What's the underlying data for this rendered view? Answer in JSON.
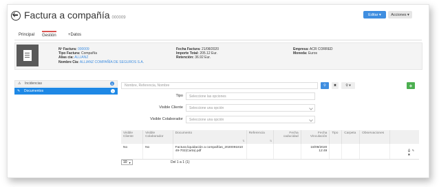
{
  "header": {
    "title": "Factura a compañía",
    "id": "000009",
    "edit_label": "Editar ▾",
    "actions_label": "Acciones ▾"
  },
  "tabs": [
    {
      "label": "Principal"
    },
    {
      "label": "Gestión"
    },
    {
      "label": "+Datos"
    }
  ],
  "info": {
    "col1": {
      "nfactura_label": "Nº Factura:",
      "nfactura_value": "000009",
      "tipo_label": "Tipo Factura:",
      "tipo_value": "Compañía",
      "alias_label": "Alias cia:",
      "alias_value": "ALLIANZ",
      "nombre_label": "Nombre Cía:",
      "nombre_value": "ALLIANZ COMPAÑÍA DE SEGUROS S.A."
    },
    "col2": {
      "fecha_label": "Fecha Factura:",
      "fecha_value": "21/08/2020",
      "importe_label": "Importe Total:",
      "importe_value": "205.12 Eur.",
      "retencion_label": "Retención:",
      "retencion_value": "36.92 Eur."
    },
    "col3": {
      "empresa_label": "Empresa:",
      "empresa_value": "ACR CORRED",
      "moneda_label": "Moneda:",
      "moneda_value": "Euros"
    }
  },
  "sidebar": {
    "items": [
      {
        "label": "Incidencias",
        "count": "0"
      },
      {
        "label": "Documentos",
        "count": "1"
      }
    ]
  },
  "search": {
    "placeholder": "Nombre, Referencia, Nombre"
  },
  "filters": {
    "tipo_label": "Tipo",
    "tipo_placeholder": "Seleccione las opciones",
    "visible_cliente_label": "Visible Cliente",
    "visible_cliente_placeholder": "Seleccione una opción",
    "visible_colaborador_label": "Visible Colaborador",
    "visible_colaborador_placeholder": "Seleccione una opción"
  },
  "table": {
    "headers": [
      "Visible Cliente",
      "Visible Colaborador",
      "Documento",
      "Referencia",
      "Fecha caducidad",
      "Fecha Vinculación",
      "Tipo",
      "Carpeta",
      "Observaciones"
    ],
    "rows": [
      {
        "visible_cliente": "No",
        "visible_colaborador": "No",
        "documento": "Factura liquidación a compañías_20200918104​9-702(Carta).pdf",
        "referencia": "",
        "fecha_caducidad": "",
        "fecha_vinculacion": "18/09/2020 12:49",
        "tipo": "",
        "carpeta": "",
        "observaciones": ""
      }
    ]
  },
  "footer": {
    "page_size": "10",
    "paging_text": "Del 1 a 1 (1)"
  },
  "colors": {
    "primary": "#3f8ee0",
    "active_tab": "#d9534f",
    "sidebar_active": "#1e88e5",
    "add_button": "#4caf50"
  }
}
